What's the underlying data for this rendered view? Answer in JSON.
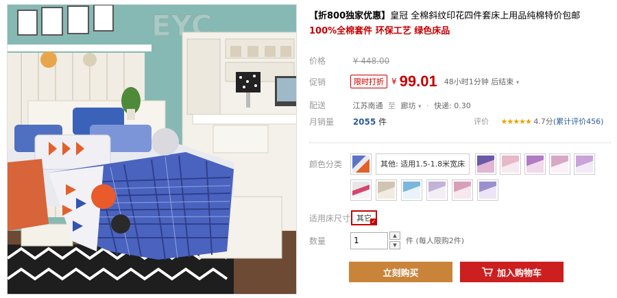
{
  "product": {
    "promo_tag": "【折800独家优惠】",
    "title": "皇冠 全棉斜纹印花四件套床上用品纯棉特价包邮",
    "subtitle": "100%全棉套件 环保工艺 绿色床品"
  },
  "price": {
    "label": "价格",
    "currency": "¥",
    "original": "448.00"
  },
  "promotion": {
    "label": "促销",
    "tag": "限时打折",
    "currency": "¥",
    "price": "99.01",
    "countdown": "48小时1分钟 后结束",
    "caret": "▾"
  },
  "shipping": {
    "label": "配送",
    "from": "江苏南通",
    "to_word": "至",
    "destination": "廊坊",
    "caret": "▾",
    "express": "快递: 0.30"
  },
  "sales": {
    "label": "月销量",
    "count": "2055",
    "unit": "件",
    "rating_label": "评价",
    "stars": "★★★★★",
    "score": "4.7分",
    "reviews": "(累计评价456)"
  },
  "options": {
    "color_label": "颜色分类",
    "selected_color_text": "其他: 适用1.5-1.8米宽床",
    "swatch_icon": "fabric-swatch",
    "size_label": "适用床尺寸",
    "size_value": "其它",
    "size_tick": "✓"
  },
  "quantity": {
    "label": "数量",
    "value": "1",
    "up": "▲",
    "down": "▼",
    "unit_note": "件 (每人限购2件)"
  },
  "buttons": {
    "buy_now": "立刻购买",
    "add_to_cart": "加入购物车",
    "cart_icon": "shopping-cart-icon"
  },
  "colors": {
    "accent_red": "#c40000",
    "buy_button": "#c9843a",
    "cart_button": "#cc1f1f",
    "link_blue": "#2b5c9f"
  }
}
